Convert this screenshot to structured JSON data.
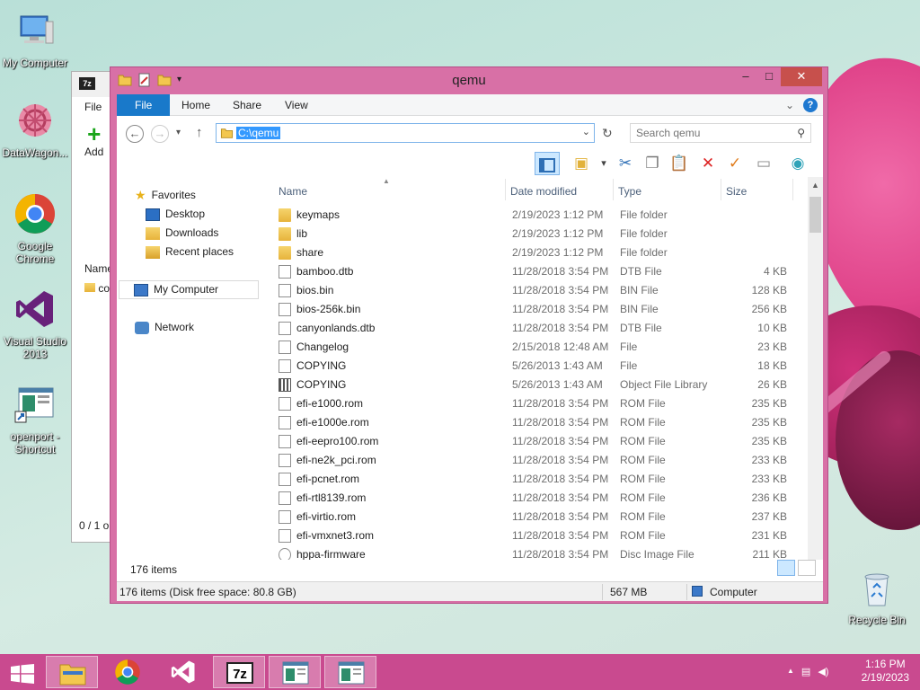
{
  "desktop": {
    "icons": [
      {
        "label": "My Computer",
        "icon": "computer-icon"
      },
      {
        "label": "DataWagon...",
        "icon": "datawagon-icon"
      },
      {
        "label": "Google Chrome",
        "icon": "chrome-icon"
      },
      {
        "label": "Visual Studio 2013",
        "icon": "visual-studio-icon"
      },
      {
        "label": "openport - Shortcut",
        "icon": "shortcut-icon"
      },
      {
        "label": "Recycle Bin",
        "icon": "recycle-bin-icon"
      }
    ]
  },
  "sevenzip": {
    "logo": "7z",
    "menu_file": "File",
    "add_label": "Add",
    "col_name": "Name",
    "row_name": "co",
    "status": "0 / 1 o"
  },
  "window": {
    "title": "qemu",
    "minimize": "–",
    "maximize": "□",
    "close": "✕"
  },
  "ribbon": {
    "tabs": [
      "File",
      "Home",
      "Share",
      "View"
    ],
    "collapse": "⌄",
    "help": "?"
  },
  "nav": {
    "back": "←",
    "forward": "→",
    "recent": "▾",
    "up": "↑",
    "address": "C:\\qemu",
    "address_dropdown": "⌄",
    "refresh": "↻",
    "search_placeholder": "Search qemu"
  },
  "navpane": {
    "favorites": "Favorites",
    "desktop": "Desktop",
    "downloads": "Downloads",
    "recent_places": "Recent places",
    "my_computer": "My Computer",
    "network": "Network"
  },
  "columns": {
    "name": "Name",
    "date": "Date modified",
    "type": "Type",
    "size": "Size"
  },
  "files": [
    {
      "name": "keymaps",
      "date": "2/19/2023 1:12 PM",
      "type": "File folder",
      "size": "",
      "icon": "folder"
    },
    {
      "name": "lib",
      "date": "2/19/2023 1:12 PM",
      "type": "File folder",
      "size": "",
      "icon": "folder"
    },
    {
      "name": "share",
      "date": "2/19/2023 1:12 PM",
      "type": "File folder",
      "size": "",
      "icon": "folder"
    },
    {
      "name": "bamboo.dtb",
      "date": "11/28/2018 3:54 PM",
      "type": "DTB File",
      "size": "4 KB",
      "icon": "doc"
    },
    {
      "name": "bios.bin",
      "date": "11/28/2018 3:54 PM",
      "type": "BIN File",
      "size": "128 KB",
      "icon": "doc"
    },
    {
      "name": "bios-256k.bin",
      "date": "11/28/2018 3:54 PM",
      "type": "BIN File",
      "size": "256 KB",
      "icon": "doc"
    },
    {
      "name": "canyonlands.dtb",
      "date": "11/28/2018 3:54 PM",
      "type": "DTB File",
      "size": "10 KB",
      "icon": "doc"
    },
    {
      "name": "Changelog",
      "date": "2/15/2018 12:48 AM",
      "type": "File",
      "size": "23 KB",
      "icon": "doc"
    },
    {
      "name": "COPYING",
      "date": "5/26/2013 1:43 AM",
      "type": "File",
      "size": "18 KB",
      "icon": "doc"
    },
    {
      "name": "COPYING",
      "date": "5/26/2013 1:43 AM",
      "type": "Object File Library",
      "size": "26 KB",
      "icon": "lib"
    },
    {
      "name": "efi-e1000.rom",
      "date": "11/28/2018 3:54 PM",
      "type": "ROM File",
      "size": "235 KB",
      "icon": "doc"
    },
    {
      "name": "efi-e1000e.rom",
      "date": "11/28/2018 3:54 PM",
      "type": "ROM File",
      "size": "235 KB",
      "icon": "doc"
    },
    {
      "name": "efi-eepro100.rom",
      "date": "11/28/2018 3:54 PM",
      "type": "ROM File",
      "size": "235 KB",
      "icon": "doc"
    },
    {
      "name": "efi-ne2k_pci.rom",
      "date": "11/28/2018 3:54 PM",
      "type": "ROM File",
      "size": "233 KB",
      "icon": "doc"
    },
    {
      "name": "efi-pcnet.rom",
      "date": "11/28/2018 3:54 PM",
      "type": "ROM File",
      "size": "233 KB",
      "icon": "doc"
    },
    {
      "name": "efi-rtl8139.rom",
      "date": "11/28/2018 3:54 PM",
      "type": "ROM File",
      "size": "236 KB",
      "icon": "doc"
    },
    {
      "name": "efi-virtio.rom",
      "date": "11/28/2018 3:54 PM",
      "type": "ROM File",
      "size": "237 KB",
      "icon": "doc"
    },
    {
      "name": "efi-vmxnet3.rom",
      "date": "11/28/2018 3:54 PM",
      "type": "ROM File",
      "size": "231 KB",
      "icon": "doc"
    },
    {
      "name": "hppa-firmware",
      "date": "11/28/2018 3:54 PM",
      "type": "Disc Image File",
      "size": "211 KB",
      "icon": "disc"
    }
  ],
  "status": {
    "item_count": "176 items",
    "footer_items": "176 items (Disk free space: 80.8 GB)",
    "footer_size": "567 MB",
    "footer_location": "Computer"
  },
  "taskbar": {
    "apps": [
      "start-button",
      "file-explorer",
      "chrome",
      "visual-studio",
      "7zip",
      "openport",
      "openport-2"
    ],
    "tray_arrow": "▲",
    "time": "1:16 PM",
    "date": "2/19/2023"
  },
  "colors": {
    "window_frame": "#d870a6",
    "taskbar": "#c94a8f",
    "ribbon_file": "#1979ca",
    "close_button": "#c7504c"
  }
}
